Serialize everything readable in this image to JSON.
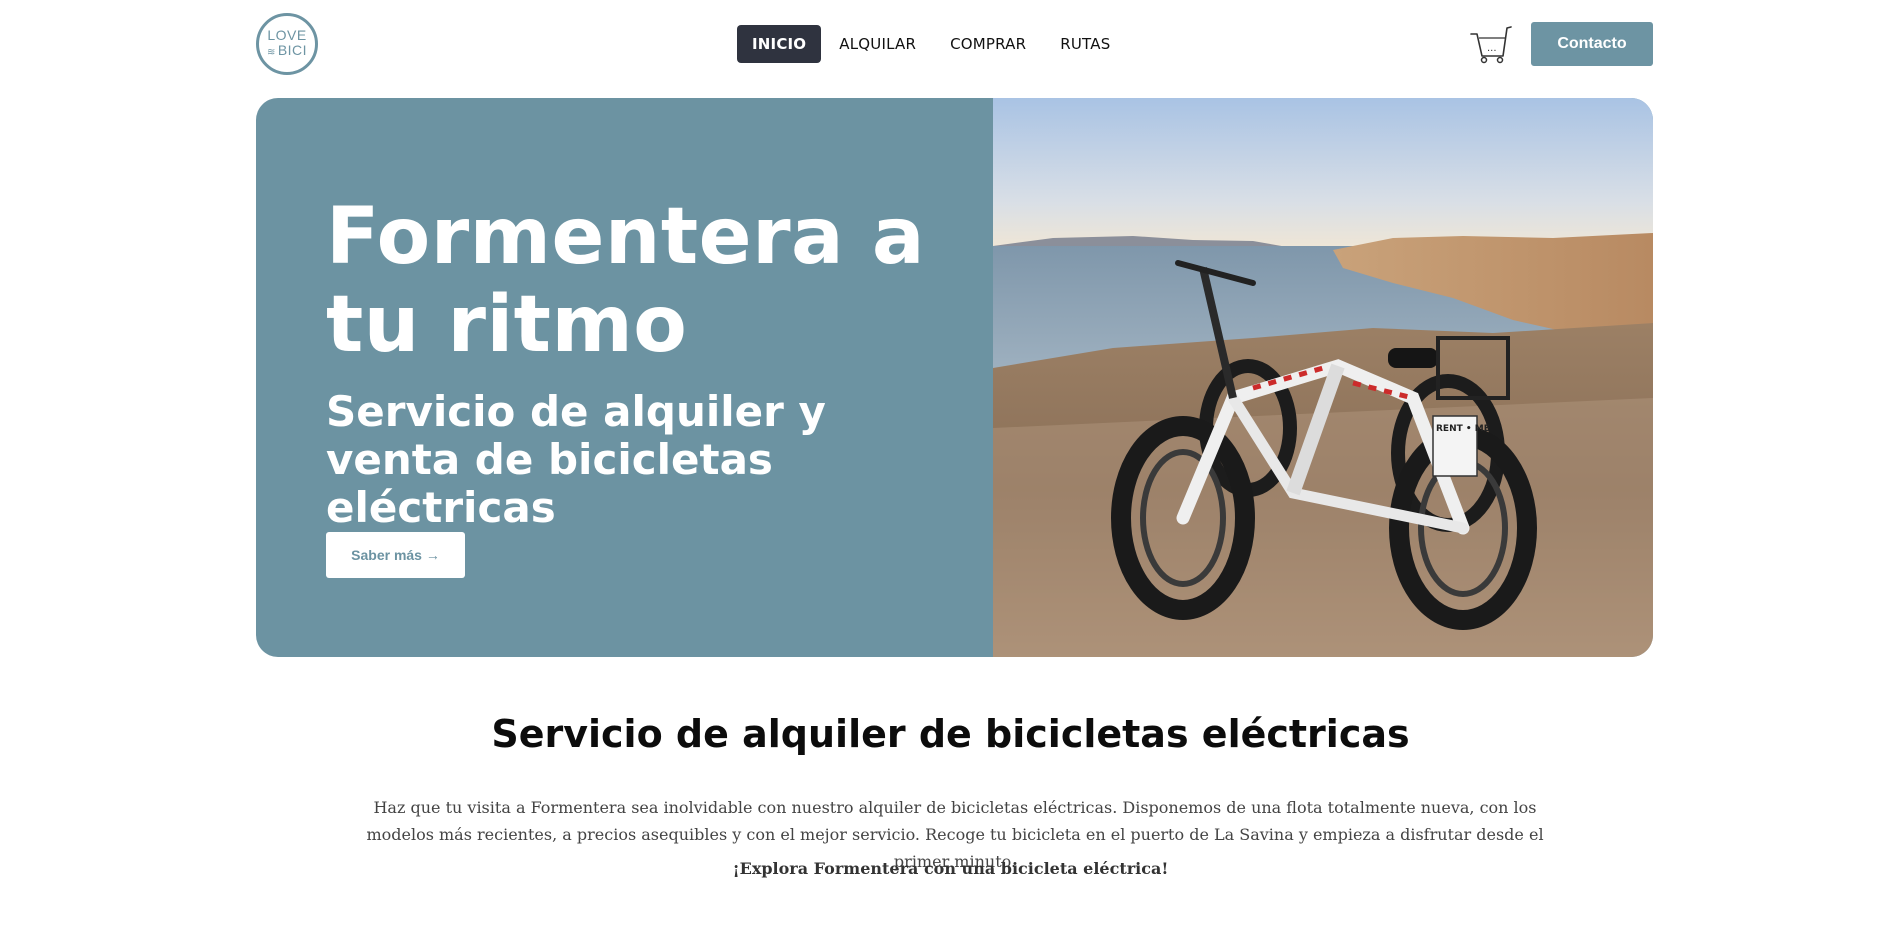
{
  "header": {
    "logo": {
      "line1": "LOVE",
      "line2": "BICI",
      "color": "#6d94a3"
    },
    "nav": [
      {
        "label": "INICIO",
        "active": true
      },
      {
        "label": "ALQUILAR",
        "active": false
      },
      {
        "label": "COMPRAR",
        "active": false
      },
      {
        "label": "RUTAS",
        "active": false
      }
    ],
    "cart_icon": "shopping-cart-icon",
    "cart_count": "...",
    "contact_label": "Contacto"
  },
  "hero": {
    "title": "Formentera a tu ritmo",
    "subtitle": "Servicio de alquiler y venta de bicicletas eléctricas",
    "button_label": "Saber más →",
    "image_sign": "RENT • ME",
    "background_color": "#6c93a2"
  },
  "section": {
    "title": "Servicio de alquiler de bicicletas eléctricas",
    "text": "Haz que tu visita a Formentera sea inolvidable con nuestro alquiler de bicicletas eléctricas. Disponemos de una flota totalmente nueva, con los modelos más recientes, a precios asequibles y con el mejor servicio. Recoge tu bicicleta en el puerto de La Savina y empieza a disfrutar desde el primer minuto.",
    "cta": "¡Explora Formentera con una bicicleta eléctrica!"
  },
  "colors": {
    "accent": "#6d94a3",
    "nav_active": "#2f333f"
  }
}
